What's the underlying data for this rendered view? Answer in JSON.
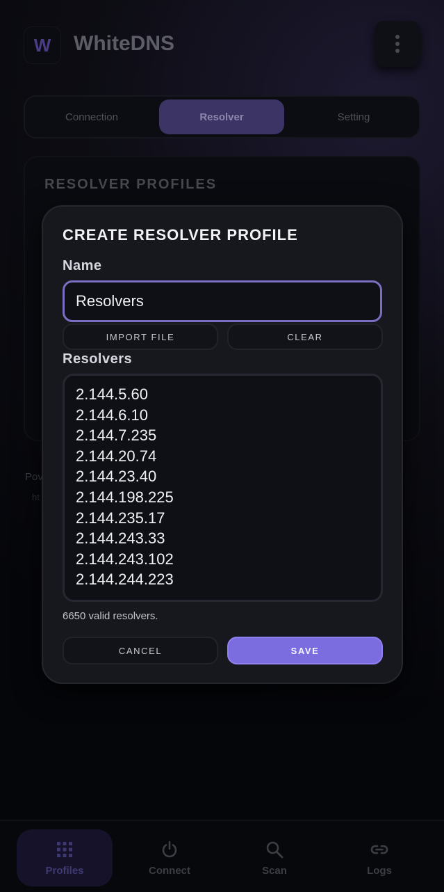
{
  "app": {
    "logo_letter": "W",
    "title": "WhiteDNS"
  },
  "tabs": [
    {
      "label": "Connection"
    },
    {
      "label": "Resolver"
    },
    {
      "label": "Setting"
    }
  ],
  "background": {
    "card_title": "RESOLVER PROFILES",
    "powered_text": "Pov",
    "link_text": "ht"
  },
  "dialog": {
    "title": "CREATE RESOLVER PROFILE",
    "name_label": "Name",
    "name_value": "Resolvers",
    "import_label": "IMPORT FILE",
    "clear_label": "CLEAR",
    "resolvers_label": "Resolvers",
    "resolvers": [
      "2.144.5.60",
      "2.144.6.10",
      "2.144.7.235",
      "2.144.20.74",
      "2.144.23.40",
      "2.144.198.225",
      "2.144.235.17",
      "2.144.243.33",
      "2.144.243.102",
      "2.144.244.223"
    ],
    "valid_text": "6650 valid resolvers.",
    "cancel_label": "CANCEL",
    "save_label": "SAVE"
  },
  "bottom_nav": [
    {
      "label": "Profiles",
      "icon": "grid-icon",
      "active": true
    },
    {
      "label": "Connect",
      "icon": "power-icon",
      "active": false
    },
    {
      "label": "Scan",
      "icon": "search-icon",
      "active": false
    },
    {
      "label": "Logs",
      "icon": "link-icon",
      "active": false
    }
  ],
  "colors": {
    "accent": "#7b6ce0",
    "input_border": "#7b6ec2",
    "background": "#07080b",
    "dialog": "#17181e"
  }
}
